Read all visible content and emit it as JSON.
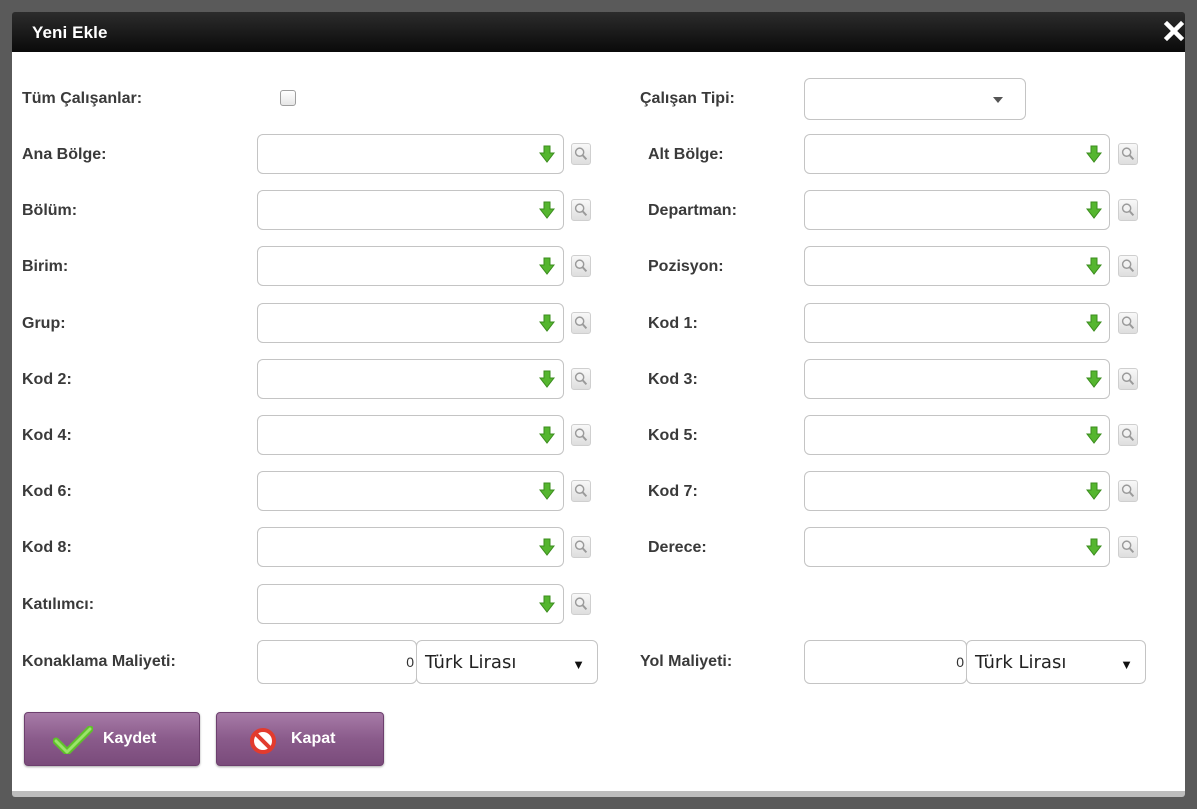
{
  "dialog": {
    "title": "Yeni Ekle"
  },
  "form": {
    "tum_calisanlar_label": "Tüm Çalışanlar:",
    "tum_calisanlar_checked": false,
    "calisan_tipi_label": "Çalışan Tipi:",
    "calisan_tipi_value": "",
    "left_fields": [
      {
        "label": "Ana Bölge:",
        "value": ""
      },
      {
        "label": "Bölüm:",
        "value": ""
      },
      {
        "label": "Birim:",
        "value": ""
      },
      {
        "label": "Grup:",
        "value": ""
      },
      {
        "label": "Kod 2:",
        "value": ""
      },
      {
        "label": "Kod 4:",
        "value": ""
      },
      {
        "label": "Kod 6:",
        "value": ""
      },
      {
        "label": "Kod 8:",
        "value": ""
      },
      {
        "label": "Katılımcı:",
        "value": ""
      }
    ],
    "right_fields": [
      {
        "label": "Alt Bölge:",
        "value": ""
      },
      {
        "label": "Departman:",
        "value": ""
      },
      {
        "label": "Pozisyon:",
        "value": ""
      },
      {
        "label": "Kod 1:",
        "value": ""
      },
      {
        "label": "Kod 3:",
        "value": ""
      },
      {
        "label": "Kod 5:",
        "value": ""
      },
      {
        "label": "Kod 7:",
        "value": ""
      },
      {
        "label": "Derece:",
        "value": ""
      }
    ],
    "konaklama_label": "Konaklama Maliyeti:",
    "konaklama_value": "0",
    "konaklama_currency": "Türk Lirası",
    "yol_label": "Yol Maliyeti:",
    "yol_value": "0",
    "yol_currency": "Türk Lirası"
  },
  "buttons": {
    "save_label": "Kaydet",
    "close_label": "Kapat"
  },
  "icons": {
    "close": "close-icon",
    "lookup_arrow": "green-down-arrow-icon",
    "search": "magnifier-icon",
    "save": "checkmark-icon",
    "cancel": "no-entry-icon"
  },
  "colors": {
    "titlebar": "#111111",
    "button": "#8a5b8b",
    "arrow": "#4caf2a"
  }
}
